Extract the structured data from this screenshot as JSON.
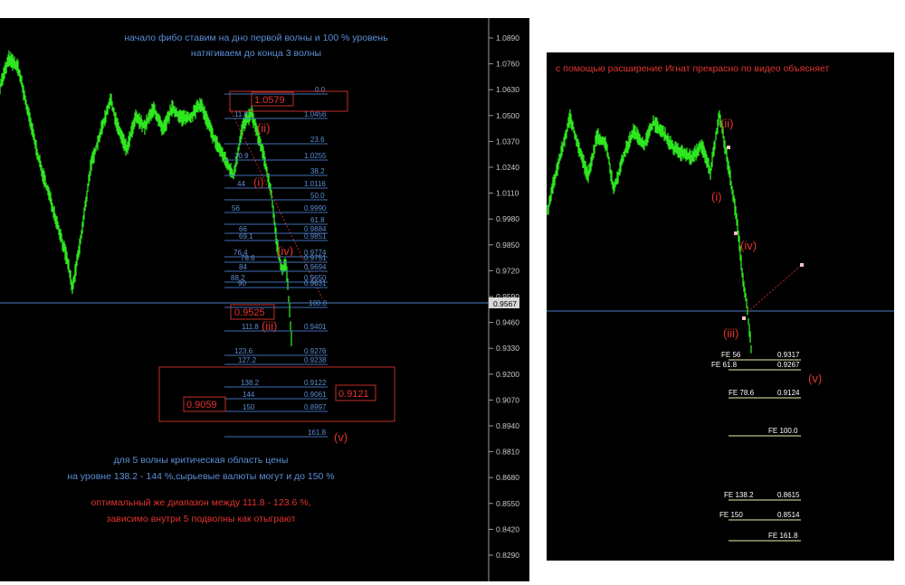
{
  "colors": {
    "background": "#000000",
    "price_line": "#2ee81f",
    "fib_blue": "#3f6fb5",
    "fib_text": "#5b8fd6",
    "label_red": "#e3342f",
    "fe_yellow": "#f2f0b0",
    "axis_text": "#c8c8c8",
    "page_white": "#ffffff"
  },
  "left_panel": {
    "annotation_top": [
      "начало фибо ставим на дно первой волны и 100 % уровень",
      "натягиваем до конца 3 волны"
    ],
    "annotation_mid": [
      "для 5 волны критическая область цены",
      "на уровне 138.2 - 144 %,сырьевые валюты могут и до 150 %"
    ],
    "annotation_bottom": [
      "оптимальный же диапазон между 111.8 - 123.6 %,",
      "зависимо внутри 5 подволны как отыграют"
    ],
    "price_boxes": [
      "1.0579",
      "0.9525",
      "0.9059",
      "0.9121"
    ],
    "current_price": "0.9567",
    "wave_labels": [
      "(ii)",
      "(i)",
      "(iv)",
      "(iii)",
      "(v)"
    ]
  },
  "right_panel": {
    "annotation_top": "с помощью расширение Игнат прекрасно по видео объясняет",
    "wave_labels": [
      "(ii)",
      "(i)",
      "(iv)",
      "(iii)",
      "(v)"
    ]
  },
  "chart_data": [
    {
      "type": "line",
      "series": [],
      "y_axis_ticks": [
        "1.0890",
        "1.0760",
        "1.0630",
        "1.0500",
        "1.0370",
        "1.0240",
        "1.0110",
        "0.9980",
        "0.9850",
        "0.9720",
        "0.9590",
        "0.9460",
        "0.9330",
        "0.9200",
        "0.9070",
        "0.8940",
        "0.8810",
        "0.8680",
        "0.8550",
        "0.8420",
        "0.8290"
      ],
      "ylim": [
        0.824,
        1.1
      ],
      "retracement_levels": [
        {
          "pct": "0.0",
          "price": ""
        },
        {
          "pct": "11.8",
          "price": "1.0456"
        },
        {
          "pct": "23.6",
          "price": ""
        },
        {
          "pct": "30.9",
          "price": "1.0255"
        },
        {
          "pct": "38.2",
          "price": ""
        },
        {
          "pct": "44",
          "price": "1.0116"
        },
        {
          "pct": "50.0",
          "price": ""
        },
        {
          "pct": "56",
          "price": "0.9990"
        },
        {
          "pct": "61.8",
          "price": ""
        },
        {
          "pct": "66",
          "price": "0.9884"
        },
        {
          "pct": "69.1",
          "price": "0.9851"
        },
        {
          "pct": "76.4",
          "price": "0.9774"
        },
        {
          "pct": "78.6",
          "price": "0.9751"
        },
        {
          "pct": "84",
          "price": "0.9694"
        },
        {
          "pct": "88.2",
          "price": "0.9650"
        },
        {
          "pct": "90",
          "price": "0.9631"
        },
        {
          "pct": "100.0",
          "price": ""
        },
        {
          "pct": "111.8",
          "price": "0.9401"
        },
        {
          "pct": "123.6",
          "price": "0.9276"
        },
        {
          "pct": "127.2",
          "price": "0.9238"
        },
        {
          "pct": "138.2",
          "price": "0.9122"
        },
        {
          "pct": "144",
          "price": "0.9061"
        },
        {
          "pct": "150",
          "price": "0.8997"
        },
        {
          "pct": "161.8",
          "price": ""
        }
      ]
    },
    {
      "type": "line",
      "series": [],
      "extension_levels": [
        {
          "label": "FE 56",
          "price": "0.9317"
        },
        {
          "label": "FE 61.8",
          "price": "0.9267"
        },
        {
          "label": "FE 78.6",
          "price": "0.9124"
        },
        {
          "label": "FE 100.0",
          "price": ""
        },
        {
          "label": "FE 138.2",
          "price": "0.8615"
        },
        {
          "label": "FE 150",
          "price": "0.8514"
        },
        {
          "label": "FE 161.8",
          "price": ""
        }
      ]
    }
  ]
}
